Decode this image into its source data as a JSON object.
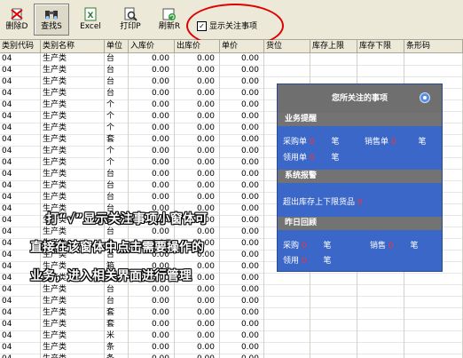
{
  "toolbar": {
    "buttons": [
      {
        "label": "删除D"
      },
      {
        "label": "查找S"
      },
      {
        "label": "Excel"
      },
      {
        "label": "打印P"
      },
      {
        "label": "刷新R"
      }
    ],
    "show_attention_checkbox": {
      "mark": "✓",
      "label": "显示关注事项"
    }
  },
  "table": {
    "headers": [
      "类别代码",
      "类别名称",
      "单位",
      "入库价",
      "出库价",
      "单价",
      "货位",
      "库存上限",
      "库存下限",
      "条形码"
    ],
    "rows": [
      {
        "code": "04",
        "name": "生产类",
        "unit": "台",
        "in": "0.00",
        "out": "0.00",
        "price": "0.00"
      },
      {
        "code": "04",
        "name": "生产类",
        "unit": "台",
        "in": "0.00",
        "out": "0.00",
        "price": "0.00"
      },
      {
        "code": "04",
        "name": "生产类",
        "unit": "台",
        "in": "0.00",
        "out": "0.00",
        "price": "0.00"
      },
      {
        "code": "04",
        "name": "生产类",
        "unit": "台",
        "in": "0.00",
        "out": "0.00",
        "price": "0.00"
      },
      {
        "code": "04",
        "name": "生产类",
        "unit": "个",
        "in": "0.00",
        "out": "0.00",
        "price": "0.00"
      },
      {
        "code": "04",
        "name": "生产类",
        "unit": "个",
        "in": "0.00",
        "out": "0.00",
        "price": "0.00"
      },
      {
        "code": "04",
        "name": "生产类",
        "unit": "个",
        "in": "0.00",
        "out": "0.00",
        "price": "0.00"
      },
      {
        "code": "04",
        "name": "生产类",
        "unit": "套",
        "in": "0.00",
        "out": "0.00",
        "price": "0.00"
      },
      {
        "code": "04",
        "name": "生产类",
        "unit": "个",
        "in": "0.00",
        "out": "0.00",
        "price": "0.00"
      },
      {
        "code": "04",
        "name": "生产类",
        "unit": "个",
        "in": "0.00",
        "out": "0.00",
        "price": "0.00"
      },
      {
        "code": "04",
        "name": "生产类",
        "unit": "台",
        "in": "0.00",
        "out": "0.00",
        "price": "0.00"
      },
      {
        "code": "04",
        "name": "生产类",
        "unit": "台",
        "in": "0.00",
        "out": "0.00",
        "price": "0.00"
      },
      {
        "code": "04",
        "name": "生产类",
        "unit": "台",
        "in": "0.00",
        "out": "0.00",
        "price": "0.00"
      },
      {
        "code": "04",
        "name": "生产类",
        "unit": "台",
        "in": "0.00",
        "out": "0.00",
        "price": "0.00"
      },
      {
        "code": "04",
        "name": "生产类",
        "unit": "台",
        "in": "0.00",
        "out": "0.00",
        "price": "0.00"
      },
      {
        "code": "04",
        "name": "生产类",
        "unit": "台",
        "in": "0.00",
        "out": "0.00",
        "price": "0.00"
      },
      {
        "code": "04",
        "name": "生产类",
        "unit": "台",
        "in": "0.00",
        "out": "0.00",
        "price": "0.00"
      },
      {
        "code": "04",
        "name": "生产类",
        "unit": "台",
        "in": "0.00",
        "out": "0.00",
        "price": "0.00"
      },
      {
        "code": "04",
        "name": "生产类",
        "unit": "箱",
        "in": "0.00",
        "out": "0.00",
        "price": "0.00"
      },
      {
        "code": "04",
        "name": "生产类",
        "unit": "台",
        "in": "0.00",
        "out": "0.00",
        "price": "0.00"
      },
      {
        "code": "04",
        "name": "生产类",
        "unit": "台",
        "in": "0.00",
        "out": "0.00",
        "price": "0.00"
      },
      {
        "code": "04",
        "name": "生产类",
        "unit": "台",
        "in": "0.00",
        "out": "0.00",
        "price": "0.00"
      },
      {
        "code": "04",
        "name": "生产类",
        "unit": "套",
        "in": "0.00",
        "out": "0.00",
        "price": "0.00"
      },
      {
        "code": "04",
        "name": "生产类",
        "unit": "套",
        "in": "0.00",
        "out": "0.00",
        "price": "0.00"
      },
      {
        "code": "04",
        "name": "生产类",
        "unit": "米",
        "in": "0.00",
        "out": "0.00",
        "price": "0.00"
      },
      {
        "code": "04",
        "name": "生产类",
        "unit": "条",
        "in": "0.00",
        "out": "0.00",
        "price": "0.00"
      },
      {
        "code": "04",
        "name": "生产类",
        "unit": "条",
        "in": "0.00",
        "out": "0.00",
        "price": "0.00"
      }
    ]
  },
  "popup": {
    "title": "您所关注的事项",
    "business_reminder": {
      "heading": "业务提醒",
      "purchase_label": "采购单",
      "purchase_count": "0",
      "purchase_suffix": "笔",
      "sales_label": "销售单",
      "sales_count": "0",
      "sales_suffix": "笔",
      "requisition_label": "领用单",
      "requisition_count": "0",
      "requisition_suffix": "笔"
    },
    "system_alarm": {
      "heading": "系统报警",
      "over_limit_label": "超出库存上下限货品",
      "over_limit_count": "0"
    },
    "yesterday_review": {
      "heading": "昨日回顾",
      "purchase_label": "采购",
      "purchase_count": "0",
      "purchase_suffix": "笔",
      "sales_label": "销售",
      "sales_count": "0",
      "sales_suffix": "笔",
      "requisition_label": "领用",
      "requisition_count": "0",
      "requisition_suffix": "笔"
    }
  },
  "annotation": {
    "line1": "打“√”显示关注事项小窗体可",
    "line2": "直接在该窗体中点击需要操作的",
    "line3": "业务，进入相关界面进行管理"
  },
  "colors": {
    "popup_bg": "#3a67c8",
    "popup_header": "#6f6f6f",
    "highlight_ellipse": "#e00000",
    "count": "#ff3030"
  }
}
